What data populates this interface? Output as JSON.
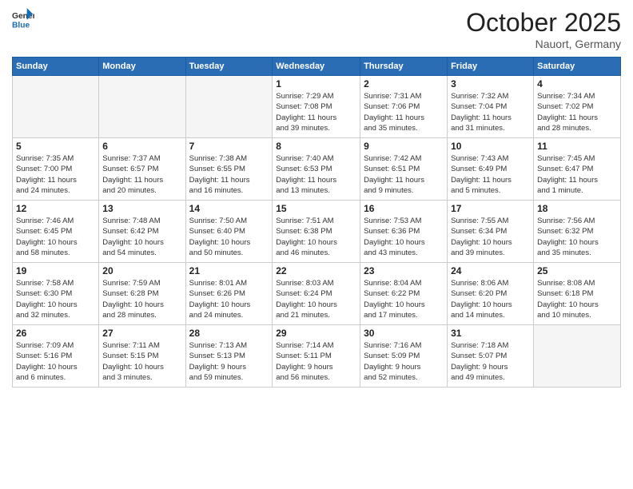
{
  "header": {
    "logo_general": "General",
    "logo_blue": "Blue",
    "month_title": "October 2025",
    "location": "Nauort, Germany"
  },
  "weekdays": [
    "Sunday",
    "Monday",
    "Tuesday",
    "Wednesday",
    "Thursday",
    "Friday",
    "Saturday"
  ],
  "weeks": [
    [
      {
        "day": "",
        "info": ""
      },
      {
        "day": "",
        "info": ""
      },
      {
        "day": "",
        "info": ""
      },
      {
        "day": "1",
        "info": "Sunrise: 7:29 AM\nSunset: 7:08 PM\nDaylight: 11 hours\nand 39 minutes."
      },
      {
        "day": "2",
        "info": "Sunrise: 7:31 AM\nSunset: 7:06 PM\nDaylight: 11 hours\nand 35 minutes."
      },
      {
        "day": "3",
        "info": "Sunrise: 7:32 AM\nSunset: 7:04 PM\nDaylight: 11 hours\nand 31 minutes."
      },
      {
        "day": "4",
        "info": "Sunrise: 7:34 AM\nSunset: 7:02 PM\nDaylight: 11 hours\nand 28 minutes."
      }
    ],
    [
      {
        "day": "5",
        "info": "Sunrise: 7:35 AM\nSunset: 7:00 PM\nDaylight: 11 hours\nand 24 minutes."
      },
      {
        "day": "6",
        "info": "Sunrise: 7:37 AM\nSunset: 6:57 PM\nDaylight: 11 hours\nand 20 minutes."
      },
      {
        "day": "7",
        "info": "Sunrise: 7:38 AM\nSunset: 6:55 PM\nDaylight: 11 hours\nand 16 minutes."
      },
      {
        "day": "8",
        "info": "Sunrise: 7:40 AM\nSunset: 6:53 PM\nDaylight: 11 hours\nand 13 minutes."
      },
      {
        "day": "9",
        "info": "Sunrise: 7:42 AM\nSunset: 6:51 PM\nDaylight: 11 hours\nand 9 minutes."
      },
      {
        "day": "10",
        "info": "Sunrise: 7:43 AM\nSunset: 6:49 PM\nDaylight: 11 hours\nand 5 minutes."
      },
      {
        "day": "11",
        "info": "Sunrise: 7:45 AM\nSunset: 6:47 PM\nDaylight: 11 hours\nand 1 minute."
      }
    ],
    [
      {
        "day": "12",
        "info": "Sunrise: 7:46 AM\nSunset: 6:45 PM\nDaylight: 10 hours\nand 58 minutes."
      },
      {
        "day": "13",
        "info": "Sunrise: 7:48 AM\nSunset: 6:42 PM\nDaylight: 10 hours\nand 54 minutes."
      },
      {
        "day": "14",
        "info": "Sunrise: 7:50 AM\nSunset: 6:40 PM\nDaylight: 10 hours\nand 50 minutes."
      },
      {
        "day": "15",
        "info": "Sunrise: 7:51 AM\nSunset: 6:38 PM\nDaylight: 10 hours\nand 46 minutes."
      },
      {
        "day": "16",
        "info": "Sunrise: 7:53 AM\nSunset: 6:36 PM\nDaylight: 10 hours\nand 43 minutes."
      },
      {
        "day": "17",
        "info": "Sunrise: 7:55 AM\nSunset: 6:34 PM\nDaylight: 10 hours\nand 39 minutes."
      },
      {
        "day": "18",
        "info": "Sunrise: 7:56 AM\nSunset: 6:32 PM\nDaylight: 10 hours\nand 35 minutes."
      }
    ],
    [
      {
        "day": "19",
        "info": "Sunrise: 7:58 AM\nSunset: 6:30 PM\nDaylight: 10 hours\nand 32 minutes."
      },
      {
        "day": "20",
        "info": "Sunrise: 7:59 AM\nSunset: 6:28 PM\nDaylight: 10 hours\nand 28 minutes."
      },
      {
        "day": "21",
        "info": "Sunrise: 8:01 AM\nSunset: 6:26 PM\nDaylight: 10 hours\nand 24 minutes."
      },
      {
        "day": "22",
        "info": "Sunrise: 8:03 AM\nSunset: 6:24 PM\nDaylight: 10 hours\nand 21 minutes."
      },
      {
        "day": "23",
        "info": "Sunrise: 8:04 AM\nSunset: 6:22 PM\nDaylight: 10 hours\nand 17 minutes."
      },
      {
        "day": "24",
        "info": "Sunrise: 8:06 AM\nSunset: 6:20 PM\nDaylight: 10 hours\nand 14 minutes."
      },
      {
        "day": "25",
        "info": "Sunrise: 8:08 AM\nSunset: 6:18 PM\nDaylight: 10 hours\nand 10 minutes."
      }
    ],
    [
      {
        "day": "26",
        "info": "Sunrise: 7:09 AM\nSunset: 5:16 PM\nDaylight: 10 hours\nand 6 minutes."
      },
      {
        "day": "27",
        "info": "Sunrise: 7:11 AM\nSunset: 5:15 PM\nDaylight: 10 hours\nand 3 minutes."
      },
      {
        "day": "28",
        "info": "Sunrise: 7:13 AM\nSunset: 5:13 PM\nDaylight: 9 hours\nand 59 minutes."
      },
      {
        "day": "29",
        "info": "Sunrise: 7:14 AM\nSunset: 5:11 PM\nDaylight: 9 hours\nand 56 minutes."
      },
      {
        "day": "30",
        "info": "Sunrise: 7:16 AM\nSunset: 5:09 PM\nDaylight: 9 hours\nand 52 minutes."
      },
      {
        "day": "31",
        "info": "Sunrise: 7:18 AM\nSunset: 5:07 PM\nDaylight: 9 hours\nand 49 minutes."
      },
      {
        "day": "",
        "info": ""
      }
    ]
  ]
}
